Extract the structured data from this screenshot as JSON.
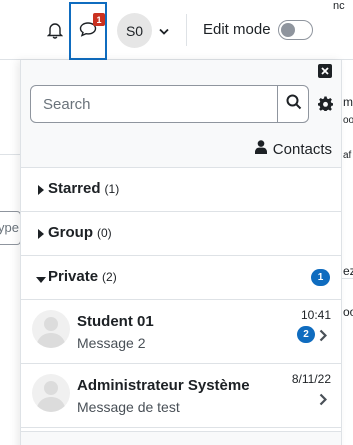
{
  "background": {
    "top_right_fragment": "nc",
    "right_edge_fragments": [
      "m",
      "oo",
      "af",
      "ez",
      "oo"
    ],
    "left_input_fragment": "ype"
  },
  "navbar": {
    "notification_icon": "bell-icon",
    "messages_icon": "chat-bubble-icon",
    "messages_badge": "1",
    "user_initials": "S0",
    "user_menu_icon": "chevron-down-icon",
    "edit_mode_label": "Edit mode",
    "edit_mode_on": false
  },
  "drawer": {
    "close_icon": "close-icon",
    "search_placeholder": "Search",
    "search_value": "",
    "search_icon": "search-icon",
    "settings_icon": "gear-icon",
    "contacts_icon": "user-icon",
    "contacts_label": "Contacts",
    "sections": [
      {
        "title": "Starred",
        "count": "(1)",
        "expanded": false,
        "badge": ""
      },
      {
        "title": "Group",
        "count": "(0)",
        "expanded": false,
        "badge": ""
      },
      {
        "title": "Private",
        "count": "(2)",
        "expanded": true,
        "badge": "1"
      }
    ],
    "conversations": [
      {
        "name": "Student 01",
        "message": "Message 2",
        "time": "10:41",
        "unread": "2"
      },
      {
        "name": "Administrateur Système",
        "message": "Message de test",
        "time": "8/11/22",
        "unread": ""
      }
    ]
  },
  "colors": {
    "accent": "#0f6cbf",
    "badge_red": "#ca3120",
    "text": "#1d2125",
    "border": "#dee2e6",
    "header_bg": "#f8f9fa"
  }
}
